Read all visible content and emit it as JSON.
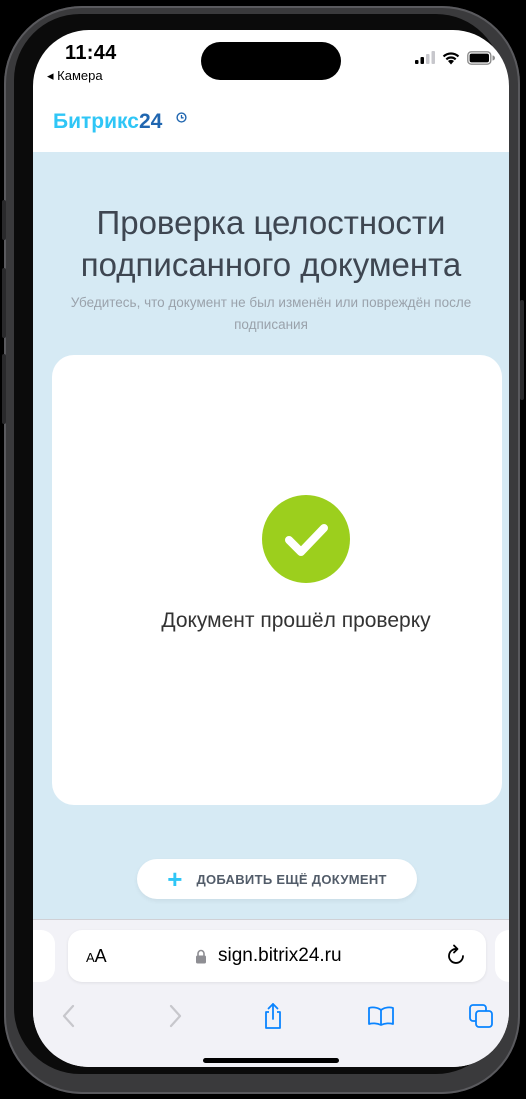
{
  "status_bar": {
    "time": "11:44",
    "back_app": "◂ Камера"
  },
  "header": {
    "logo_text": "Битрикс",
    "logo_number": "24"
  },
  "page": {
    "title": "Проверка целостности подписанного документа",
    "subtitle": "Убедитесь, что документ не был изменён или повреждён после подписания"
  },
  "result": {
    "message": "Документ прошёл проверку",
    "status": "success"
  },
  "add_button": {
    "label": "ДОБАВИТЬ ЕЩЁ ДОКУМЕНТ",
    "icon": "+"
  },
  "browser": {
    "text_size_label_small": "A",
    "text_size_label_large": "A",
    "url": "sign.bitrix24.ru",
    "toolbar_icons": [
      "back-icon",
      "forward-icon",
      "share-icon",
      "bookmarks-icon",
      "tabs-icon"
    ]
  },
  "colors": {
    "accent": "#2fc6f6",
    "brand_dark": "#2066b0",
    "success": "#9ccf1d",
    "page_bg": "#d6eaf4",
    "ios_blue": "#0a84ff"
  }
}
